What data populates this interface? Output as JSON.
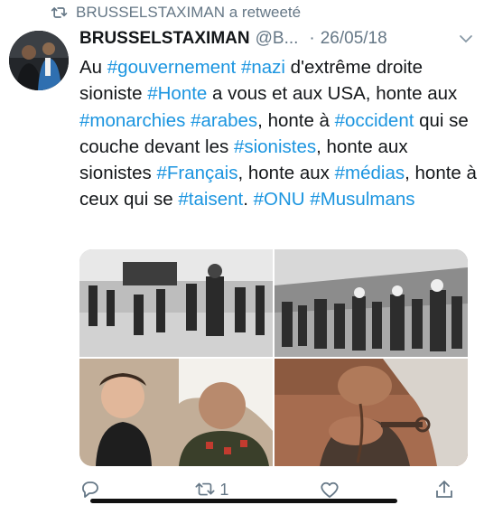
{
  "retweet": {
    "icon": "retweet-icon",
    "label": "BRUSSELSTAXIMAN a retweeté"
  },
  "tweet": {
    "author_name": "BRUSSELSTAXIMAN",
    "handle": "@B...",
    "separator": "·",
    "date": "26/05/18",
    "text_parts": [
      {
        "t": "Au ",
        "tag": false
      },
      {
        "t": "#gouvernement",
        "tag": true
      },
      {
        "t": " ",
        "tag": false
      },
      {
        "t": "#nazi",
        "tag": true
      },
      {
        "t": " d'extrême droite sioniste ",
        "tag": false
      },
      {
        "t": "#Honte",
        "tag": true
      },
      {
        "t": " a vous et aux USA, honte aux ",
        "tag": false
      },
      {
        "t": "#monarchies",
        "tag": true
      },
      {
        "t": " ",
        "tag": false
      },
      {
        "t": "#arabes",
        "tag": true
      },
      {
        "t": ", honte à ",
        "tag": false
      },
      {
        "t": "#occident",
        "tag": true
      },
      {
        "t": " qui se couche devant les ",
        "tag": false
      },
      {
        "t": "#sionistes",
        "tag": true
      },
      {
        "t": ", honte aux sionistes ",
        "tag": false
      },
      {
        "t": "#Français",
        "tag": true
      },
      {
        "t": ", honte aux ",
        "tag": false
      },
      {
        "t": "#médias",
        "tag": true
      },
      {
        "t": ", honte à ceux qui se ",
        "tag": false
      },
      {
        "t": "#taisent",
        "tag": true
      },
      {
        "t": ". ",
        "tag": false
      },
      {
        "t": "#ONU",
        "tag": true
      },
      {
        "t": " ",
        "tag": false
      },
      {
        "t": "#Musulmans",
        "tag": true
      }
    ]
  },
  "media": [
    {
      "name": "media-photo-refugees-water",
      "tone": "bw"
    },
    {
      "name": "media-photo-refugees-march",
      "tone": "bw"
    },
    {
      "name": "media-photo-child-and-grandmother",
      "tone": "color"
    },
    {
      "name": "media-photo-key-in-hands",
      "tone": "color"
    }
  ],
  "actions": {
    "reply": {
      "icon": "reply-icon",
      "count": ""
    },
    "retweet": {
      "icon": "retweet-icon",
      "count": "1"
    },
    "like": {
      "icon": "heart-icon",
      "count": ""
    },
    "share": {
      "icon": "share-icon",
      "count": ""
    }
  },
  "colors": {
    "link": "#1b95e0",
    "muted": "#657786",
    "text": "#14171a"
  }
}
